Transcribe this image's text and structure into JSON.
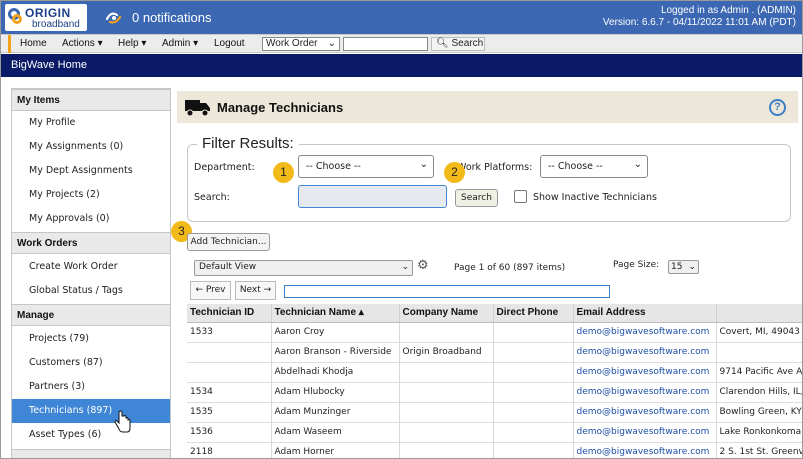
{
  "header": {
    "logo_word1": "ORIGIN",
    "logo_word2": "broadband",
    "notifications": "0 notifications",
    "login_line1": "Logged in as Admin . (ADMIN)",
    "login_line2": "Version: 6.6.7 - 04/11/2022 11:01 AM (PDT)"
  },
  "menubar": {
    "items": [
      "Home",
      "Actions ▾",
      "Help ▾",
      "Admin ▾",
      "Logout"
    ],
    "search_type": "Work Order",
    "search_label": "Search",
    "search_value": ""
  },
  "homebar": {
    "title": "BigWave Home"
  },
  "sidebar": {
    "my_items": {
      "heading": "My Items",
      "items": [
        "My Profile",
        "My Assignments (0)",
        "My Dept Assignments",
        "My Projects (2)",
        "My Approvals (0)"
      ]
    },
    "work_orders": {
      "heading": "Work Orders",
      "items": [
        "Create Work Order",
        "Global Status / Tags"
      ]
    },
    "manage": {
      "heading": "Manage",
      "items": [
        "Projects (79)",
        "Customers (87)",
        "Partners (3)",
        "Technicians (897)",
        "Asset Types (6)"
      ]
    }
  },
  "page": {
    "title": "Manage Technicians",
    "help": "?"
  },
  "filter": {
    "legend": "Filter Results:",
    "department_label": "Department:",
    "department_value": "-- Choose --",
    "work_platforms_label": "Work Platforms:",
    "work_platforms_value": "-- Choose --",
    "search_label": "Search:",
    "search_value": "",
    "search_button": "Search",
    "inactive_label": "Show Inactive Technicians"
  },
  "badges": [
    "1",
    "2",
    "3"
  ],
  "actions": {
    "add_button": "Add Technician..."
  },
  "grid": {
    "view": "Default View",
    "page_info": "Page 1 of 60 (897 items)",
    "page_size_label": "Page Size:",
    "page_size": "15",
    "prev": "← Prev",
    "next": "Next →",
    "page_input": "",
    "columns": [
      "Technician ID",
      "Technician Name ▴",
      "Company Name",
      "Direct Phone",
      "Email Address",
      ""
    ],
    "rows": [
      [
        "1533",
        "Aaron Croy",
        "",
        "",
        "demo@bigwavesoftware.com",
        "Covert, MI, 49043"
      ],
      [
        "",
        "Aaron Branson - Riverside",
        "Origin Broadband",
        "",
        "demo@bigwavesoftware.com",
        ""
      ],
      [
        "",
        "Abdelhadi Khodja",
        "",
        "",
        "demo@bigwavesoftware.com",
        "9714 Pacific Ave Ap"
      ],
      [
        "1534",
        "Adam Hlubocky",
        "",
        "",
        "demo@bigwavesoftware.com",
        "Clarendon Hills, IL,"
      ],
      [
        "1535",
        "Adam Munzinger",
        "",
        "",
        "demo@bigwavesoftware.com",
        "Bowling Green, KY,"
      ],
      [
        "1536",
        "Adam Waseem",
        "",
        "",
        "demo@bigwavesoftware.com",
        "Lake Ronkonkoma,"
      ],
      [
        "2118",
        "Adam Horner",
        "",
        "",
        "demo@bigwavesoftware.com",
        "2 S. 1st St. Greenv"
      ]
    ]
  },
  "colors": {
    "header_blue": "#3b67b3",
    "home_bar": "#0b1a67",
    "active_item": "#3f87d6",
    "badge": "#f2ba18",
    "accent": "#f3a21b"
  }
}
